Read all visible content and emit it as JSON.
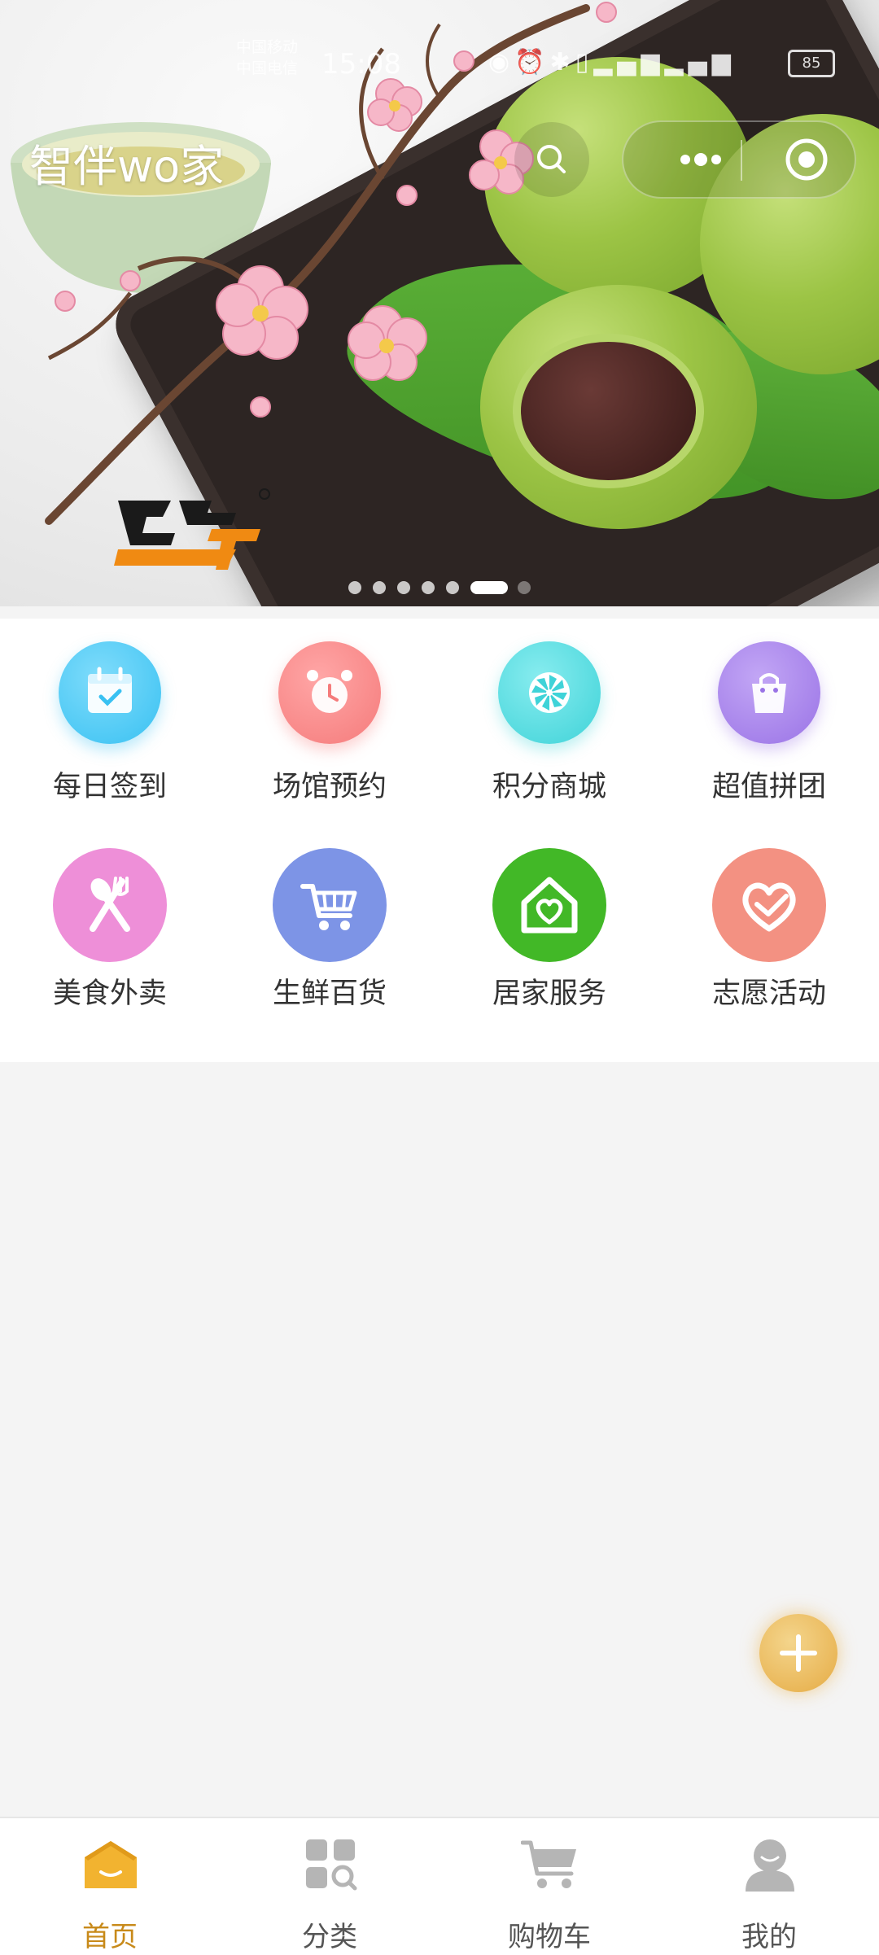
{
  "status_bar": {
    "carrier_1": "中国移动",
    "carrier_2": "中国电信",
    "time": "15:08",
    "battery": "85"
  },
  "header": {
    "title": "智伴wo家"
  },
  "banner": {
    "slide_count": 7,
    "active_slide": 6
  },
  "grid": [
    {
      "label": "每日签到",
      "icon": "calendar-check-icon",
      "color": "#39c1f2"
    },
    {
      "label": "场馆预约",
      "icon": "alarm-clock-icon",
      "color": "#f57b7b"
    },
    {
      "label": "积分商城",
      "icon": "pinwheel-icon",
      "color": "#3fd3d8"
    },
    {
      "label": "超值拼团",
      "icon": "shopping-bag-icon",
      "color": "#9a73e6"
    },
    {
      "label": "美食外卖",
      "icon": "fork-spoon-icon",
      "color": "#ee8fd8"
    },
    {
      "label": "生鲜百货",
      "icon": "shopping-cart-icon",
      "color": "#7d94e6"
    },
    {
      "label": "居家服务",
      "icon": "home-heart-icon",
      "color": "#42b827"
    },
    {
      "label": "志愿活动",
      "icon": "heart-hand-icon",
      "color": "#f39182"
    }
  ],
  "tabs": [
    {
      "label": "首页",
      "icon": "home-icon",
      "active": true
    },
    {
      "label": "分类",
      "icon": "category-icon",
      "active": false
    },
    {
      "label": "购物车",
      "icon": "cart-icon",
      "active": false
    },
    {
      "label": "我的",
      "icon": "user-icon",
      "active": false
    }
  ],
  "colors": {
    "accent": "#c88a1a",
    "fab": "#eab85a",
    "page_bg": "#f4f4f4"
  }
}
